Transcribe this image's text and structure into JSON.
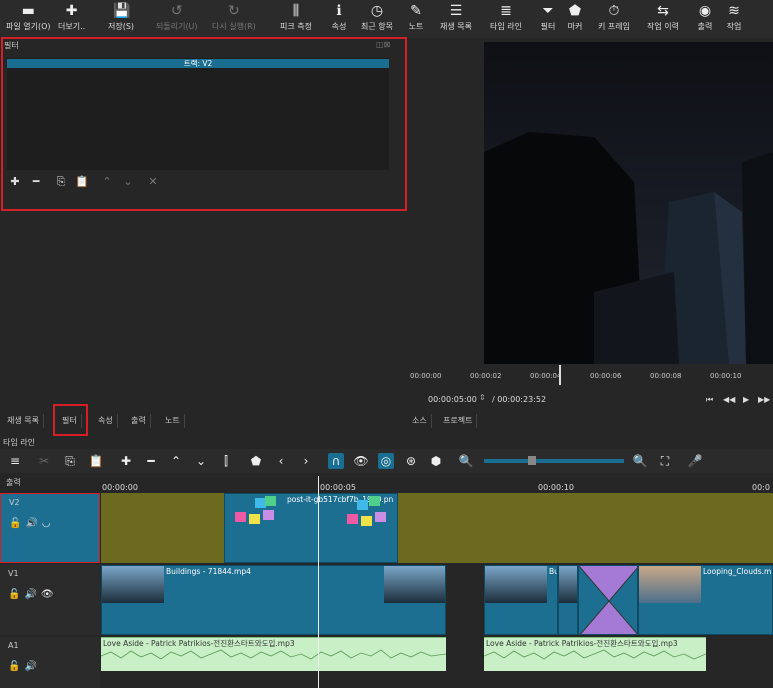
{
  "toolbar": {
    "items": [
      {
        "label": "파일 열기(O)",
        "icon": "folder-icon",
        "disabled": false
      },
      {
        "label": "더보기..",
        "icon": "more-icon",
        "disabled": false
      },
      {
        "label": "저장(S)",
        "icon": "save-icon",
        "disabled": false
      },
      {
        "label": "되돌리기(U)",
        "icon": "undo-icon",
        "disabled": true
      },
      {
        "label": "다시 실행(R)",
        "icon": "redo-icon",
        "disabled": true
      },
      {
        "label": "피크 측정",
        "icon": "peak-meter-icon",
        "disabled": false
      },
      {
        "label": "속성",
        "icon": "info-icon",
        "disabled": false
      },
      {
        "label": "최근 항목",
        "icon": "clock-icon",
        "disabled": false
      },
      {
        "label": "노트",
        "icon": "note-icon",
        "disabled": false
      },
      {
        "label": "재생 목록",
        "icon": "list-icon",
        "disabled": false
      },
      {
        "label": "타임 라인",
        "icon": "timeline-icon",
        "disabled": false
      },
      {
        "label": "필터",
        "icon": "filter-icon",
        "disabled": false
      },
      {
        "label": "마커",
        "icon": "marker-icon",
        "disabled": false
      },
      {
        "label": "키 프레임",
        "icon": "stopwatch-icon",
        "disabled": false
      },
      {
        "label": "작업 이력",
        "icon": "history-icon",
        "disabled": false
      },
      {
        "label": "출력",
        "icon": "export-icon",
        "disabled": false
      },
      {
        "label": "작업",
        "icon": "jobs-icon",
        "disabled": false
      }
    ]
  },
  "filters": {
    "title": "필터",
    "track_label": "트랙: V2"
  },
  "left_tabs": [
    "재생 목록",
    "필터",
    "속성",
    "출력",
    "노트"
  ],
  "player": {
    "ruler_ticks": [
      "00:00:00",
      "00:00:02",
      "00:00:04",
      "00:00:06",
      "00:00:08",
      "00:00:10"
    ],
    "current_time": "00:00:05:00",
    "total_time": "/ 00:00:23:52",
    "tabs": [
      "소스",
      "프로젝트"
    ]
  },
  "timeline": {
    "title": "타임 라인",
    "output_label": "출력",
    "ruler_ticks": [
      "00:00:00",
      "00:00:05",
      "00:00:10",
      "00:0"
    ],
    "tracks": [
      {
        "name": "V2"
      },
      {
        "name": "V1"
      },
      {
        "name": "A1"
      }
    ],
    "clips": {
      "v2_postit": "post-it-gb517cbf7b_1920.pn",
      "v1_buildings": "Buildings - 71844.mp4",
      "v1_bu": "Bu",
      "v1_clouds": "Looping_Clouds.m",
      "a1_clip1": "Love Aside - Patrick Patrikios-전진환스타트와도입.mp3",
      "a1_clip2": "Love Aside - Patrick Patrikios-전진환스타트와도입.mp3"
    }
  }
}
